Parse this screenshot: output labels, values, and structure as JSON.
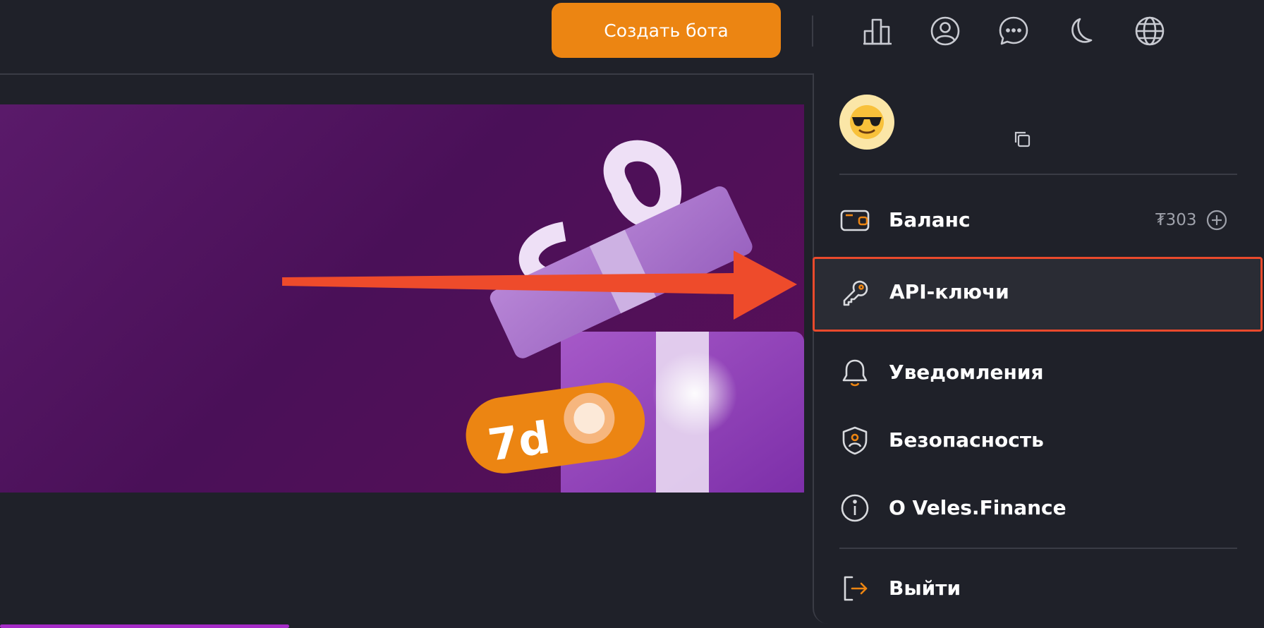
{
  "header": {
    "create_bot_label": "Создать бота",
    "icons": [
      "stats-icon",
      "profile-icon",
      "chat-icon",
      "theme-icon",
      "language-icon"
    ]
  },
  "banner": {
    "badge_text": "7d"
  },
  "dropdown": {
    "avatar_emoji": "sunglasses-emoji",
    "menu": {
      "balance_label": "Баланс",
      "balance_value": "₮303",
      "api_keys_label": "API-ключи",
      "notifications_label": "Уведомления",
      "security_label": "Безопасность",
      "about_label": "О Veles.Finance",
      "logout_label": "Выйти"
    }
  },
  "colors": {
    "background": "#1f2129",
    "accent_orange": "#ec8512",
    "highlight_red": "#e94a2c",
    "banner_purple": "#4a1058"
  }
}
